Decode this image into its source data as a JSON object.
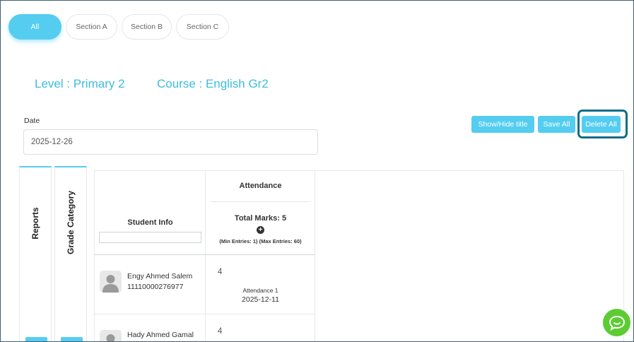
{
  "tabs": [
    {
      "label": "All",
      "active": true
    },
    {
      "label": "Section A",
      "active": false
    },
    {
      "label": "Section B",
      "active": false
    },
    {
      "label": "Section C",
      "active": false
    }
  ],
  "level": "Level : Primary 2",
  "course": "Course : English Gr2",
  "date": {
    "label": "Date",
    "value": "2025-12-26"
  },
  "actions": {
    "show_hide_title": "Show/Hide title",
    "save_all": "Save All",
    "delete_all": "Delete All"
  },
  "side_tabs": {
    "reports": "Reports",
    "grade_category": "Grade Category"
  },
  "table": {
    "student_info_header": "Student Info",
    "student_filter_value": "",
    "attendance": {
      "title": "Attendance",
      "total_marks": "Total Marks: 5",
      "entries": "(Min Entries: 1) (Max Entries: 60)"
    },
    "rows": [
      {
        "name": "Engy Ahmed Salem",
        "id": "11110000276977",
        "mark": "4",
        "attendance_name": "Attendance 1",
        "attendance_date": "2025-12-11"
      },
      {
        "name": "Hady Ahmed Gamal",
        "id": "",
        "mark": "4",
        "attendance_name": "",
        "attendance_date": ""
      }
    ]
  },
  "icons": {
    "plus": "plus-circle-icon",
    "avatar": "user-avatar-icon",
    "chat": "chat-icon"
  },
  "colors": {
    "accent": "#54cdf0",
    "heading": "#3bbde0",
    "highlight_ring": "#0e6d86",
    "chat": "#5ccc32"
  }
}
